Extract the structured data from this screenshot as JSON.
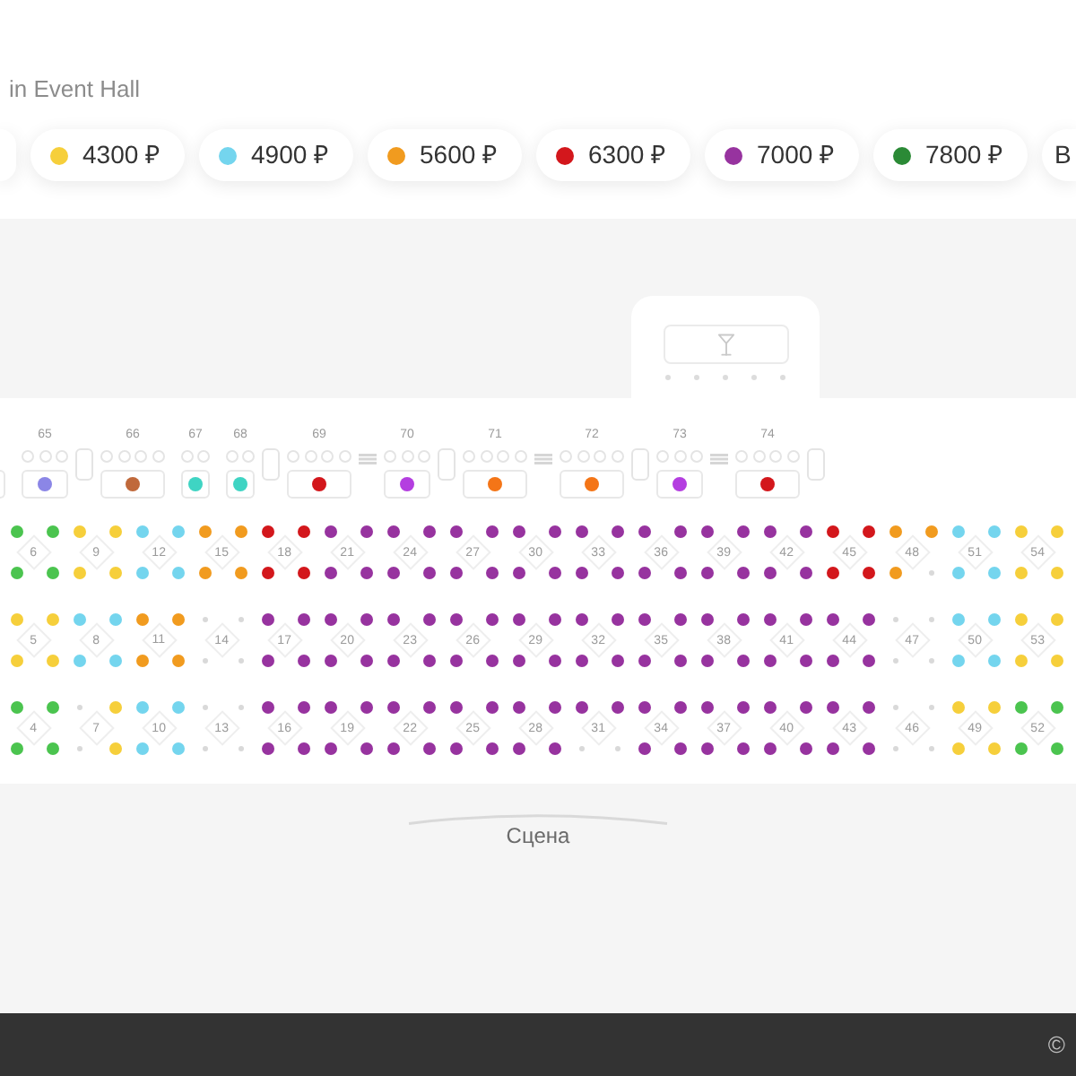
{
  "venue": {
    "title": "in Event Hall"
  },
  "price_filters": [
    {
      "label": "4300 ₽",
      "color": "#f6cf3b"
    },
    {
      "label": "4900 ₽",
      "color": "#74d5ee"
    },
    {
      "label": "5600 ₽",
      "color": "#f19b1f"
    },
    {
      "label": "6300 ₽",
      "color": "#d3171c"
    },
    {
      "label": "7000 ₽",
      "color": "#97339f"
    },
    {
      "label": "7800 ₽",
      "color": "#2b8a36"
    },
    {
      "label": "В"
    }
  ],
  "floor_items": [
    {
      "kind": "partial"
    },
    {
      "kind": "trio",
      "number": "65",
      "color": "#8b86e6"
    },
    {
      "kind": "pillar"
    },
    {
      "kind": "quad",
      "number": "66",
      "color": "#c0693b"
    },
    {
      "kind": "duo",
      "number": "67",
      "color": "#3fd4c3"
    },
    {
      "kind": "duo",
      "number": "68",
      "color": "#3fd4c3"
    },
    {
      "kind": "pillar"
    },
    {
      "kind": "quad",
      "number": "69",
      "color": "#d3171c"
    },
    {
      "kind": "stairs"
    },
    {
      "kind": "trio",
      "number": "70",
      "color": "#b43ee0"
    },
    {
      "kind": "pillar"
    },
    {
      "kind": "quad",
      "number": "71",
      "color": "#f47517"
    },
    {
      "kind": "stairs"
    },
    {
      "kind": "quad",
      "number": "72",
      "color": "#f47517"
    },
    {
      "kind": "pillar"
    },
    {
      "kind": "trio",
      "number": "73",
      "color": "#b43ee0"
    },
    {
      "kind": "stairs"
    },
    {
      "kind": "quad",
      "number": "74",
      "color": "#d3171c"
    },
    {
      "kind": "pillar"
    }
  ],
  "seat_rows": [
    {
      "tables": [
        {
          "number": "6",
          "seats": [
            {
              "color": "#4bc44f",
              "taken": false
            },
            {
              "color": "#4bc44f",
              "taken": false
            },
            {
              "color": "#4bc44f",
              "taken": false
            },
            {
              "color": "#4bc44f",
              "taken": false
            }
          ]
        },
        {
          "number": "9",
          "seats": [
            {
              "color": "#f6cf3b",
              "taken": false
            },
            {
              "color": "#f6cf3b",
              "taken": false
            },
            {
              "color": "#f6cf3b",
              "taken": false
            },
            {
              "color": "#f6cf3b",
              "taken": false
            }
          ]
        },
        {
          "number": "12",
          "seats": [
            {
              "color": "#74d5ee",
              "taken": false
            },
            {
              "color": "#74d5ee",
              "taken": false
            },
            {
              "color": "#74d5ee",
              "taken": false
            },
            {
              "color": "#74d5ee",
              "taken": false
            }
          ]
        },
        {
          "number": "15",
          "seats": [
            {
              "color": "#f19b1f",
              "taken": false
            },
            {
              "color": "#f19b1f",
              "taken": false
            },
            {
              "color": "#f19b1f",
              "taken": false
            },
            {
              "color": "#f19b1f",
              "taken": false
            }
          ]
        },
        {
          "number": "18",
          "seats": [
            {
              "color": "#d3171c",
              "taken": false
            },
            {
              "color": "#d3171c",
              "taken": false
            },
            {
              "color": "#d3171c",
              "taken": false
            },
            {
              "color": "#d3171c",
              "taken": false
            }
          ]
        },
        {
          "number": "21",
          "seats": [
            {
              "color": "#97339f",
              "taken": false
            },
            {
              "color": "#97339f",
              "taken": false
            },
            {
              "color": "#97339f",
              "taken": false
            },
            {
              "color": "#97339f",
              "taken": false
            }
          ]
        },
        {
          "number": "24",
          "seats": [
            {
              "color": "#97339f",
              "taken": false
            },
            {
              "color": "#97339f",
              "taken": false
            },
            {
              "color": "#97339f",
              "taken": false
            },
            {
              "color": "#97339f",
              "taken": false
            }
          ]
        },
        {
          "number": "27",
          "seats": [
            {
              "color": "#97339f",
              "taken": false
            },
            {
              "color": "#97339f",
              "taken": false
            },
            {
              "color": "#97339f",
              "taken": false
            },
            {
              "color": "#97339f",
              "taken": false
            }
          ]
        },
        {
          "number": "30",
          "seats": [
            {
              "color": "#97339f",
              "taken": false
            },
            {
              "color": "#97339f",
              "taken": false
            },
            {
              "color": "#97339f",
              "taken": false
            },
            {
              "color": "#97339f",
              "taken": false
            }
          ]
        },
        {
          "number": "33",
          "seats": [
            {
              "color": "#97339f",
              "taken": false
            },
            {
              "color": "#97339f",
              "taken": false
            },
            {
              "color": "#97339f",
              "taken": false
            },
            {
              "color": "#97339f",
              "taken": false
            }
          ]
        },
        {
          "number": "36",
          "seats": [
            {
              "color": "#97339f",
              "taken": false
            },
            {
              "color": "#97339f",
              "taken": false
            },
            {
              "color": "#97339f",
              "taken": false
            },
            {
              "color": "#97339f",
              "taken": false
            }
          ]
        },
        {
          "number": "39",
          "seats": [
            {
              "color": "#97339f",
              "taken": false
            },
            {
              "color": "#97339f",
              "taken": false
            },
            {
              "color": "#97339f",
              "taken": false
            },
            {
              "color": "#97339f",
              "taken": false
            }
          ]
        },
        {
          "number": "42",
          "seats": [
            {
              "color": "#97339f",
              "taken": false
            },
            {
              "color": "#97339f",
              "taken": false
            },
            {
              "color": "#97339f",
              "taken": false
            },
            {
              "color": "#97339f",
              "taken": false
            }
          ]
        },
        {
          "number": "45",
          "seats": [
            {
              "color": "#d3171c",
              "taken": false
            },
            {
              "color": "#d3171c",
              "taken": false
            },
            {
              "color": "#d3171c",
              "taken": false
            },
            {
              "color": "#d3171c",
              "taken": false
            }
          ]
        },
        {
          "number": "48",
          "seats": [
            {
              "color": "#f19b1f",
              "taken": false
            },
            {
              "color": "#f19b1f",
              "taken": false
            },
            {
              "color": "#f19b1f",
              "taken": false
            },
            {
              "taken": true
            }
          ]
        },
        {
          "number": "51",
          "seats": [
            {
              "color": "#74d5ee",
              "taken": false
            },
            {
              "color": "#74d5ee",
              "taken": false
            },
            {
              "color": "#74d5ee",
              "taken": false
            },
            {
              "color": "#74d5ee",
              "taken": false
            }
          ]
        },
        {
          "number": "54",
          "seats": [
            {
              "color": "#f6cf3b",
              "taken": false
            },
            {
              "color": "#f6cf3b",
              "taken": false
            },
            {
              "color": "#f6cf3b",
              "taken": false
            },
            {
              "color": "#f6cf3b",
              "taken": false
            }
          ]
        }
      ]
    },
    {
      "tables": [
        {
          "number": "5",
          "seats": [
            {
              "color": "#f6cf3b",
              "taken": false
            },
            {
              "color": "#f6cf3b",
              "taken": false
            },
            {
              "color": "#f6cf3b",
              "taken": false
            },
            {
              "color": "#f6cf3b",
              "taken": false
            }
          ]
        },
        {
          "number": "8",
          "seats": [
            {
              "color": "#74d5ee",
              "taken": false
            },
            {
              "color": "#74d5ee",
              "taken": false
            },
            {
              "color": "#74d5ee",
              "taken": false
            },
            {
              "color": "#74d5ee",
              "taken": false
            }
          ]
        },
        {
          "number": "11",
          "seats": [
            {
              "color": "#f19b1f",
              "taken": false
            },
            {
              "color": "#f19b1f",
              "taken": false
            },
            {
              "color": "#f19b1f",
              "taken": false
            },
            {
              "color": "#f19b1f",
              "taken": false
            }
          ]
        },
        {
          "number": "14",
          "seats": [
            {
              "taken": true
            },
            {
              "taken": true
            },
            {
              "taken": true
            },
            {
              "taken": true
            }
          ]
        },
        {
          "number": "17",
          "seats": [
            {
              "color": "#97339f",
              "taken": false
            },
            {
              "color": "#97339f",
              "taken": false
            },
            {
              "color": "#97339f",
              "taken": false
            },
            {
              "color": "#97339f",
              "taken": false
            }
          ]
        },
        {
          "number": "20",
          "seats": [
            {
              "color": "#97339f",
              "taken": false
            },
            {
              "color": "#97339f",
              "taken": false
            },
            {
              "color": "#97339f",
              "taken": false
            },
            {
              "color": "#97339f",
              "taken": false
            }
          ]
        },
        {
          "number": "23",
          "seats": [
            {
              "color": "#97339f",
              "taken": false
            },
            {
              "color": "#97339f",
              "taken": false
            },
            {
              "color": "#97339f",
              "taken": false
            },
            {
              "color": "#97339f",
              "taken": false
            }
          ]
        },
        {
          "number": "26",
          "seats": [
            {
              "color": "#97339f",
              "taken": false
            },
            {
              "color": "#97339f",
              "taken": false
            },
            {
              "color": "#97339f",
              "taken": false
            },
            {
              "color": "#97339f",
              "taken": false
            }
          ]
        },
        {
          "number": "29",
          "seats": [
            {
              "color": "#97339f",
              "taken": false
            },
            {
              "color": "#97339f",
              "taken": false
            },
            {
              "color": "#97339f",
              "taken": false
            },
            {
              "color": "#97339f",
              "taken": false
            }
          ]
        },
        {
          "number": "32",
          "seats": [
            {
              "color": "#97339f",
              "taken": false
            },
            {
              "color": "#97339f",
              "taken": false
            },
            {
              "color": "#97339f",
              "taken": false
            },
            {
              "color": "#97339f",
              "taken": false
            }
          ]
        },
        {
          "number": "35",
          "seats": [
            {
              "color": "#97339f",
              "taken": false
            },
            {
              "color": "#97339f",
              "taken": false
            },
            {
              "color": "#97339f",
              "taken": false
            },
            {
              "color": "#97339f",
              "taken": false
            }
          ]
        },
        {
          "number": "38",
          "seats": [
            {
              "color": "#97339f",
              "taken": false
            },
            {
              "color": "#97339f",
              "taken": false
            },
            {
              "color": "#97339f",
              "taken": false
            },
            {
              "color": "#97339f",
              "taken": false
            }
          ]
        },
        {
          "number": "41",
          "seats": [
            {
              "color": "#97339f",
              "taken": false
            },
            {
              "color": "#97339f",
              "taken": false
            },
            {
              "color": "#97339f",
              "taken": false
            },
            {
              "color": "#97339f",
              "taken": false
            }
          ]
        },
        {
          "number": "44",
          "seats": [
            {
              "color": "#97339f",
              "taken": false
            },
            {
              "color": "#97339f",
              "taken": false
            },
            {
              "color": "#97339f",
              "taken": false
            },
            {
              "color": "#97339f",
              "taken": false
            }
          ]
        },
        {
          "number": "47",
          "seats": [
            {
              "taken": true
            },
            {
              "taken": true
            },
            {
              "taken": true
            },
            {
              "taken": true
            }
          ]
        },
        {
          "number": "50",
          "seats": [
            {
              "color": "#74d5ee",
              "taken": false
            },
            {
              "color": "#74d5ee",
              "taken": false
            },
            {
              "color": "#74d5ee",
              "taken": false
            },
            {
              "color": "#74d5ee",
              "taken": false
            }
          ]
        },
        {
          "number": "53",
          "seats": [
            {
              "color": "#f6cf3b",
              "taken": false
            },
            {
              "color": "#f6cf3b",
              "taken": false
            },
            {
              "color": "#f6cf3b",
              "taken": false
            },
            {
              "color": "#f6cf3b",
              "taken": false
            }
          ]
        }
      ]
    },
    {
      "tables": [
        {
          "number": "4",
          "seats": [
            {
              "color": "#4bc44f",
              "taken": false
            },
            {
              "color": "#4bc44f",
              "taken": false
            },
            {
              "color": "#4bc44f",
              "taken": false
            },
            {
              "color": "#4bc44f",
              "taken": false
            }
          ]
        },
        {
          "number": "7",
          "seats": [
            {
              "taken": true
            },
            {
              "color": "#f6cf3b",
              "taken": false
            },
            {
              "taken": true
            },
            {
              "color": "#f6cf3b",
              "taken": false
            }
          ]
        },
        {
          "number": "10",
          "seats": [
            {
              "color": "#74d5ee",
              "taken": false
            },
            {
              "color": "#74d5ee",
              "taken": false
            },
            {
              "color": "#74d5ee",
              "taken": false
            },
            {
              "color": "#74d5ee",
              "taken": false
            }
          ]
        },
        {
          "number": "13",
          "seats": [
            {
              "taken": true
            },
            {
              "taken": true
            },
            {
              "taken": true
            },
            {
              "taken": true
            }
          ]
        },
        {
          "number": "16",
          "seats": [
            {
              "color": "#97339f",
              "taken": false
            },
            {
              "color": "#97339f",
              "taken": false
            },
            {
              "color": "#97339f",
              "taken": false
            },
            {
              "color": "#97339f",
              "taken": false
            }
          ]
        },
        {
          "number": "19",
          "seats": [
            {
              "color": "#97339f",
              "taken": false
            },
            {
              "color": "#97339f",
              "taken": false
            },
            {
              "color": "#97339f",
              "taken": false
            },
            {
              "color": "#97339f",
              "taken": false
            }
          ]
        },
        {
          "number": "22",
          "seats": [
            {
              "color": "#97339f",
              "taken": false
            },
            {
              "color": "#97339f",
              "taken": false
            },
            {
              "color": "#97339f",
              "taken": false
            },
            {
              "color": "#97339f",
              "taken": false
            }
          ]
        },
        {
          "number": "25",
          "seats": [
            {
              "color": "#97339f",
              "taken": false
            },
            {
              "color": "#97339f",
              "taken": false
            },
            {
              "color": "#97339f",
              "taken": false
            },
            {
              "color": "#97339f",
              "taken": false
            }
          ]
        },
        {
          "number": "28",
          "seats": [
            {
              "color": "#97339f",
              "taken": false
            },
            {
              "color": "#97339f",
              "taken": false
            },
            {
              "color": "#97339f",
              "taken": false
            },
            {
              "color": "#97339f",
              "taken": false
            }
          ]
        },
        {
          "number": "31",
          "seats": [
            {
              "color": "#97339f",
              "taken": false
            },
            {
              "color": "#97339f",
              "taken": false
            },
            {
              "taken": true
            },
            {
              "taken": true
            }
          ]
        },
        {
          "number": "34",
          "seats": [
            {
              "color": "#97339f",
              "taken": false
            },
            {
              "color": "#97339f",
              "taken": false
            },
            {
              "color": "#97339f",
              "taken": false
            },
            {
              "color": "#97339f",
              "taken": false
            }
          ]
        },
        {
          "number": "37",
          "seats": [
            {
              "color": "#97339f",
              "taken": false
            },
            {
              "color": "#97339f",
              "taken": false
            },
            {
              "color": "#97339f",
              "taken": false
            },
            {
              "color": "#97339f",
              "taken": false
            }
          ]
        },
        {
          "number": "40",
          "seats": [
            {
              "color": "#97339f",
              "taken": false
            },
            {
              "color": "#97339f",
              "taken": false
            },
            {
              "color": "#97339f",
              "taken": false
            },
            {
              "color": "#97339f",
              "taken": false
            }
          ]
        },
        {
          "number": "43",
          "seats": [
            {
              "color": "#97339f",
              "taken": false
            },
            {
              "color": "#97339f",
              "taken": false
            },
            {
              "color": "#97339f",
              "taken": false
            },
            {
              "color": "#97339f",
              "taken": false
            }
          ]
        },
        {
          "number": "46",
          "seats": [
            {
              "taken": true
            },
            {
              "taken": true
            },
            {
              "taken": true
            },
            {
              "taken": true
            }
          ]
        },
        {
          "number": "49",
          "seats": [
            {
              "color": "#f6cf3b",
              "taken": false
            },
            {
              "color": "#f6cf3b",
              "taken": false
            },
            {
              "color": "#f6cf3b",
              "taken": false
            },
            {
              "color": "#f6cf3b",
              "taken": false
            }
          ]
        },
        {
          "number": "52",
          "seats": [
            {
              "color": "#4bc44f",
              "taken": false
            },
            {
              "color": "#4bc44f",
              "taken": false
            },
            {
              "color": "#4bc44f",
              "taken": false
            },
            {
              "color": "#4bc44f",
              "taken": false
            }
          ]
        }
      ]
    }
  ],
  "stage": {
    "label": "Сцена"
  },
  "footer": {
    "copyright": "©"
  }
}
